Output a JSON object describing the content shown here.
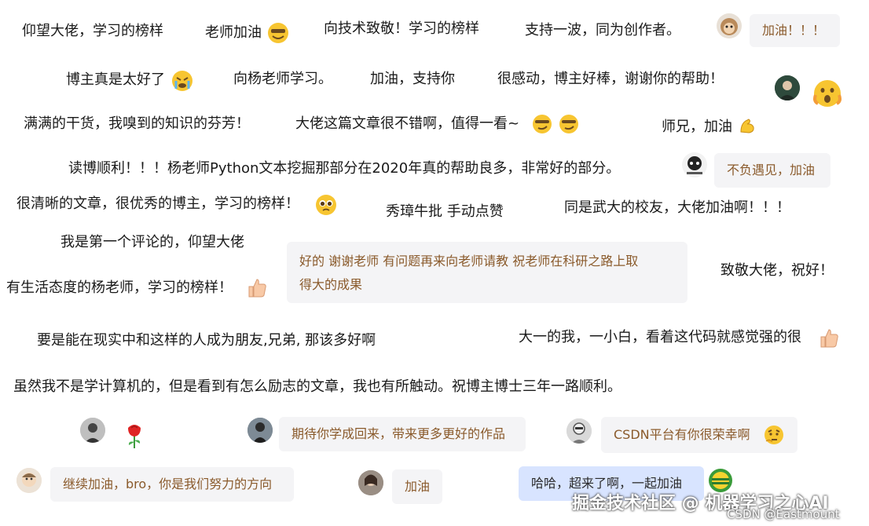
{
  "comments": [
    "仰望大佬，学习的榜样",
    "老师加油",
    "向技术致敬！学习的榜样",
    "支持一波，同为创作者。",
    "博主真是太好了",
    "向杨老师学习。",
    "加油，支持你",
    "很感动，博主好棒，谢谢你的帮助！",
    "满满的干货，我嗅到的知识的芬芳！",
    "大佬这篇文章很不错啊，值得一看~",
    "师兄，加油",
    "读博顺利！！！杨老师Python文本挖掘那部分在2020年真的帮助良多，非常好的部分。",
    "很清晰的文章，很优秀的博主，学习的榜样！",
    "秀璋牛批 手动点赞",
    "同是武大的校友，大佬加油啊！！！",
    "我是第一个评论的，仰望大佬",
    "致敬大佬，祝好！",
    "有生活态度的杨老师，学习的榜样！",
    "要是能在现实中和这样的人成为朋友,兄弟, 那该多好啊",
    "大一的我，一小白，看着这代码就感觉强的很",
    "虽然我不是学计算机的，但是看到有怎么励志的文章，我也有所触动。祝博主博士三年一路顺利。"
  ],
  "bubbles": [
    "加油！！！",
    "不负遇见，加油",
    "好的  谢谢老师  有问题再来向老师请教  祝老师在科研之路上取",
    "得大的成果",
    "期待你学成回来，带来更多更好的作品",
    "CSDN平台有你很荣幸啊",
    "继续加油，bro，你是我们努力的方向",
    "加油",
    "哈哈，超来了啊，一起加油"
  ],
  "watermark": {
    "main": "掘金技术社区 @ 机器学习之心AI",
    "sub": "CSDN @Eastmount"
  },
  "icons": [
    "grin-emoji",
    "monkey-avatar",
    "crying-emoji",
    "fearful-emoji",
    "smirk-emoji",
    "flexed-biceps-emoji",
    "pleading-emoji",
    "thumbs-up-emoji",
    "rose-emoji",
    "thinking-emoji"
  ],
  "colors": {
    "bubble_bg": "#f4f4f6",
    "bubble_text": "#8a5a2b",
    "bubble_blue_bg": "#d8e4ff",
    "emoji_yellow": "#f7c531"
  }
}
